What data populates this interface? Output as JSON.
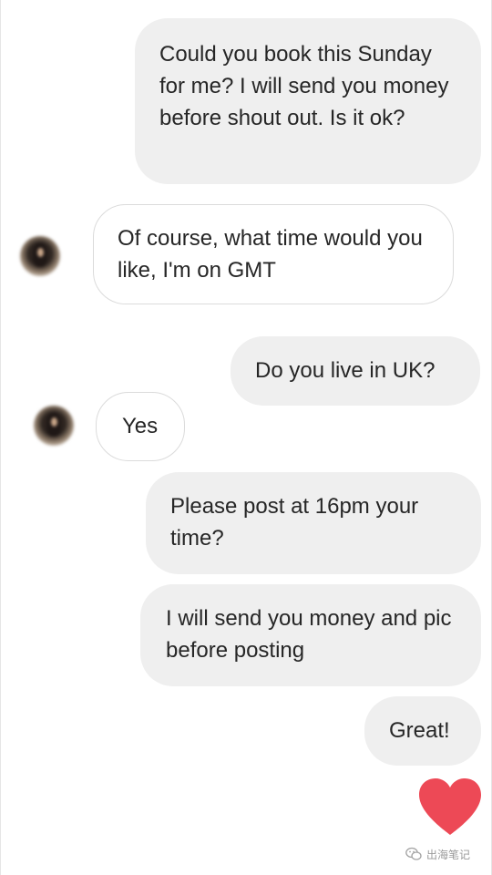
{
  "messages": [
    {
      "from": "me",
      "text": "Could you book this Sunday for me? I will send you money before shout out. Is it ok?"
    },
    {
      "from": "them",
      "text": "Of course, what time would you like, I'm on GMT"
    },
    {
      "from": "me",
      "text": "Do you live in UK?"
    },
    {
      "from": "them",
      "text": "Yes"
    },
    {
      "from": "me",
      "text": "Please post at 16pm your time?"
    },
    {
      "from": "me",
      "text": "I will send you money and pic before posting"
    },
    {
      "from": "me",
      "text": "Great!"
    }
  ],
  "reaction": {
    "icon": "heart-icon",
    "color": "#ed4956"
  },
  "watermark": {
    "icon": "wechat-icon",
    "text": "出海笔记"
  },
  "colors": {
    "sent_bubble": "#efefef",
    "received_border": "#dbdbdb",
    "text": "#262626"
  }
}
